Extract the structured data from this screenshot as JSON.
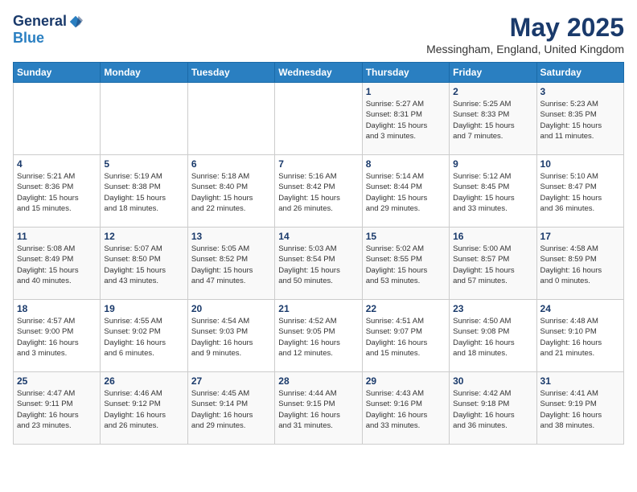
{
  "header": {
    "logo_general": "General",
    "logo_blue": "Blue",
    "month_title": "May 2025",
    "location": "Messingham, England, United Kingdom"
  },
  "days_of_week": [
    "Sunday",
    "Monday",
    "Tuesday",
    "Wednesday",
    "Thursday",
    "Friday",
    "Saturday"
  ],
  "weeks": [
    [
      {
        "day": "",
        "info": ""
      },
      {
        "day": "",
        "info": ""
      },
      {
        "day": "",
        "info": ""
      },
      {
        "day": "",
        "info": ""
      },
      {
        "day": "1",
        "info": "Sunrise: 5:27 AM\nSunset: 8:31 PM\nDaylight: 15 hours\nand 3 minutes."
      },
      {
        "day": "2",
        "info": "Sunrise: 5:25 AM\nSunset: 8:33 PM\nDaylight: 15 hours\nand 7 minutes."
      },
      {
        "day": "3",
        "info": "Sunrise: 5:23 AM\nSunset: 8:35 PM\nDaylight: 15 hours\nand 11 minutes."
      }
    ],
    [
      {
        "day": "4",
        "info": "Sunrise: 5:21 AM\nSunset: 8:36 PM\nDaylight: 15 hours\nand 15 minutes."
      },
      {
        "day": "5",
        "info": "Sunrise: 5:19 AM\nSunset: 8:38 PM\nDaylight: 15 hours\nand 18 minutes."
      },
      {
        "day": "6",
        "info": "Sunrise: 5:18 AM\nSunset: 8:40 PM\nDaylight: 15 hours\nand 22 minutes."
      },
      {
        "day": "7",
        "info": "Sunrise: 5:16 AM\nSunset: 8:42 PM\nDaylight: 15 hours\nand 26 minutes."
      },
      {
        "day": "8",
        "info": "Sunrise: 5:14 AM\nSunset: 8:44 PM\nDaylight: 15 hours\nand 29 minutes."
      },
      {
        "day": "9",
        "info": "Sunrise: 5:12 AM\nSunset: 8:45 PM\nDaylight: 15 hours\nand 33 minutes."
      },
      {
        "day": "10",
        "info": "Sunrise: 5:10 AM\nSunset: 8:47 PM\nDaylight: 15 hours\nand 36 minutes."
      }
    ],
    [
      {
        "day": "11",
        "info": "Sunrise: 5:08 AM\nSunset: 8:49 PM\nDaylight: 15 hours\nand 40 minutes."
      },
      {
        "day": "12",
        "info": "Sunrise: 5:07 AM\nSunset: 8:50 PM\nDaylight: 15 hours\nand 43 minutes."
      },
      {
        "day": "13",
        "info": "Sunrise: 5:05 AM\nSunset: 8:52 PM\nDaylight: 15 hours\nand 47 minutes."
      },
      {
        "day": "14",
        "info": "Sunrise: 5:03 AM\nSunset: 8:54 PM\nDaylight: 15 hours\nand 50 minutes."
      },
      {
        "day": "15",
        "info": "Sunrise: 5:02 AM\nSunset: 8:55 PM\nDaylight: 15 hours\nand 53 minutes."
      },
      {
        "day": "16",
        "info": "Sunrise: 5:00 AM\nSunset: 8:57 PM\nDaylight: 15 hours\nand 57 minutes."
      },
      {
        "day": "17",
        "info": "Sunrise: 4:58 AM\nSunset: 8:59 PM\nDaylight: 16 hours\nand 0 minutes."
      }
    ],
    [
      {
        "day": "18",
        "info": "Sunrise: 4:57 AM\nSunset: 9:00 PM\nDaylight: 16 hours\nand 3 minutes."
      },
      {
        "day": "19",
        "info": "Sunrise: 4:55 AM\nSunset: 9:02 PM\nDaylight: 16 hours\nand 6 minutes."
      },
      {
        "day": "20",
        "info": "Sunrise: 4:54 AM\nSunset: 9:03 PM\nDaylight: 16 hours\nand 9 minutes."
      },
      {
        "day": "21",
        "info": "Sunrise: 4:52 AM\nSunset: 9:05 PM\nDaylight: 16 hours\nand 12 minutes."
      },
      {
        "day": "22",
        "info": "Sunrise: 4:51 AM\nSunset: 9:07 PM\nDaylight: 16 hours\nand 15 minutes."
      },
      {
        "day": "23",
        "info": "Sunrise: 4:50 AM\nSunset: 9:08 PM\nDaylight: 16 hours\nand 18 minutes."
      },
      {
        "day": "24",
        "info": "Sunrise: 4:48 AM\nSunset: 9:10 PM\nDaylight: 16 hours\nand 21 minutes."
      }
    ],
    [
      {
        "day": "25",
        "info": "Sunrise: 4:47 AM\nSunset: 9:11 PM\nDaylight: 16 hours\nand 23 minutes."
      },
      {
        "day": "26",
        "info": "Sunrise: 4:46 AM\nSunset: 9:12 PM\nDaylight: 16 hours\nand 26 minutes."
      },
      {
        "day": "27",
        "info": "Sunrise: 4:45 AM\nSunset: 9:14 PM\nDaylight: 16 hours\nand 29 minutes."
      },
      {
        "day": "28",
        "info": "Sunrise: 4:44 AM\nSunset: 9:15 PM\nDaylight: 16 hours\nand 31 minutes."
      },
      {
        "day": "29",
        "info": "Sunrise: 4:43 AM\nSunset: 9:16 PM\nDaylight: 16 hours\nand 33 minutes."
      },
      {
        "day": "30",
        "info": "Sunrise: 4:42 AM\nSunset: 9:18 PM\nDaylight: 16 hours\nand 36 minutes."
      },
      {
        "day": "31",
        "info": "Sunrise: 4:41 AM\nSunset: 9:19 PM\nDaylight: 16 hours\nand 38 minutes."
      }
    ]
  ]
}
